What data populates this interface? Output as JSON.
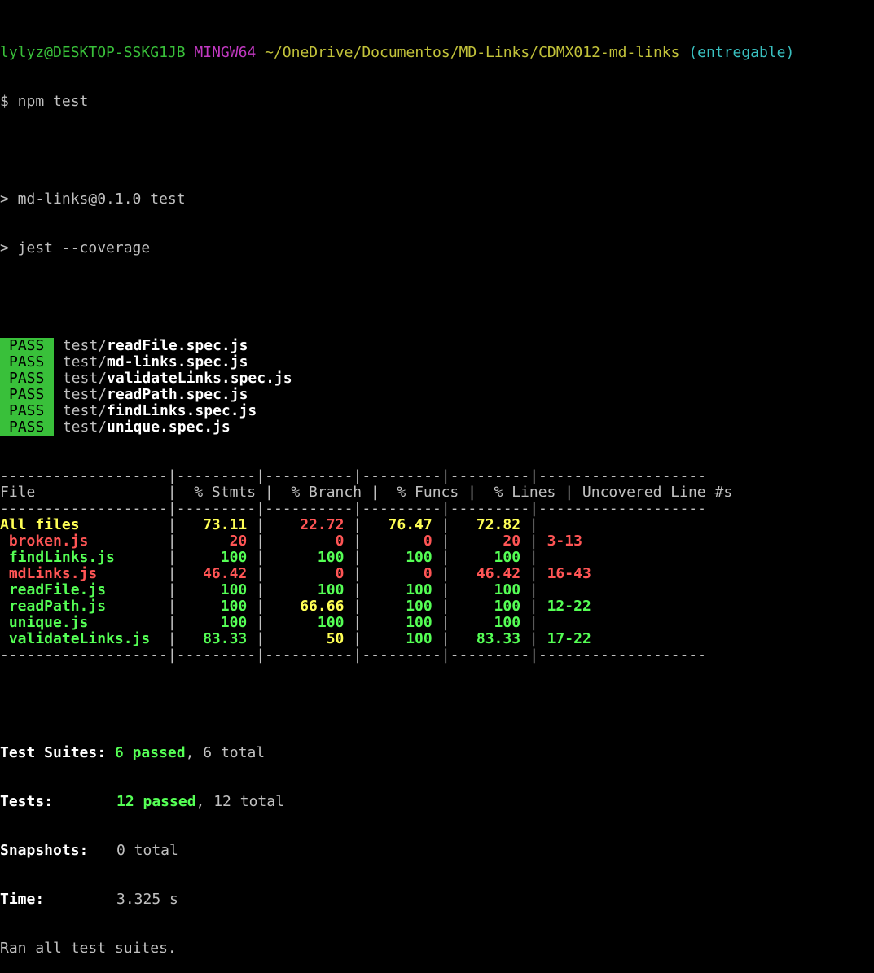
{
  "prompt": {
    "user_host": "lylyz@DESKTOP-SSKG1JB",
    "system": "MINGW64",
    "path": "~/OneDrive/Documentos/MD-Links/CDMX012-md-links",
    "branch": "(entregable)"
  },
  "command": "$ npm test",
  "script_lines": [
    "> md-links@0.1.0 test",
    "> jest --coverage"
  ],
  "pass_label": "PASS",
  "tests": [
    {
      "dir": "test/",
      "file": "readFile.spec.js"
    },
    {
      "dir": "test/",
      "file": "md-links.spec.js"
    },
    {
      "dir": "test/",
      "file": "validateLinks.spec.js"
    },
    {
      "dir": "test/",
      "file": "readPath.spec.js"
    },
    {
      "dir": "test/",
      "file": "findLinks.spec.js"
    },
    {
      "dir": "test/",
      "file": "unique.spec.js"
    }
  ],
  "coverage": {
    "separator": "-------------------|---------|----------|---------|---------|-------------------",
    "headers": [
      "File",
      "% Stmts",
      "% Branch",
      "% Funcs",
      "% Lines",
      "Uncovered Line #s"
    ],
    "rows": [
      {
        "file": "All files",
        "stmts": "73.11",
        "branch": "22.72",
        "funcs": "76.47",
        "lines": "72.82",
        "uncovered": ""
      },
      {
        "file": " broken.js",
        "stmts": "20",
        "branch": "0",
        "funcs": "0",
        "lines": "20",
        "uncovered": "3-13"
      },
      {
        "file": " findLinks.js",
        "stmts": "100",
        "branch": "100",
        "funcs": "100",
        "lines": "100",
        "uncovered": ""
      },
      {
        "file": " mdLinks.js",
        "stmts": "46.42",
        "branch": "0",
        "funcs": "0",
        "lines": "46.42",
        "uncovered": "16-43"
      },
      {
        "file": " readFile.js",
        "stmts": "100",
        "branch": "100",
        "funcs": "100",
        "lines": "100",
        "uncovered": ""
      },
      {
        "file": " readPath.js",
        "stmts": "100",
        "branch": "66.66",
        "funcs": "100",
        "lines": "100",
        "uncovered": "12-22"
      },
      {
        "file": " unique.js",
        "stmts": "100",
        "branch": "100",
        "funcs": "100",
        "lines": "100",
        "uncovered": ""
      },
      {
        "file": " validateLinks.js",
        "stmts": "83.33",
        "branch": "50",
        "funcs": "100",
        "lines": "83.33",
        "uncovered": "17-22"
      }
    ]
  },
  "summary": {
    "suites_label": "Test Suites:",
    "suites_passed": "6 passed",
    "suites_total": ", 6 total",
    "tests_label": "Tests:",
    "tests_passed": "12 passed",
    "tests_total": ", 12 total",
    "snapshots_label": "Snapshots:",
    "snapshots_value": "0 total",
    "time_label": "Time:",
    "time_value": "3.325 s",
    "ran": "Ran all test suites."
  },
  "colors": {
    "background": "#000000",
    "text": "#c0c0c0",
    "user": "#39c03a",
    "mingw": "#c239c2",
    "path": "#c2c23a",
    "branch": "#3ac2c2",
    "pass_bg": "#39c03a",
    "high": "#55ff55",
    "medium": "#ffff55",
    "low": "#ff5555"
  }
}
